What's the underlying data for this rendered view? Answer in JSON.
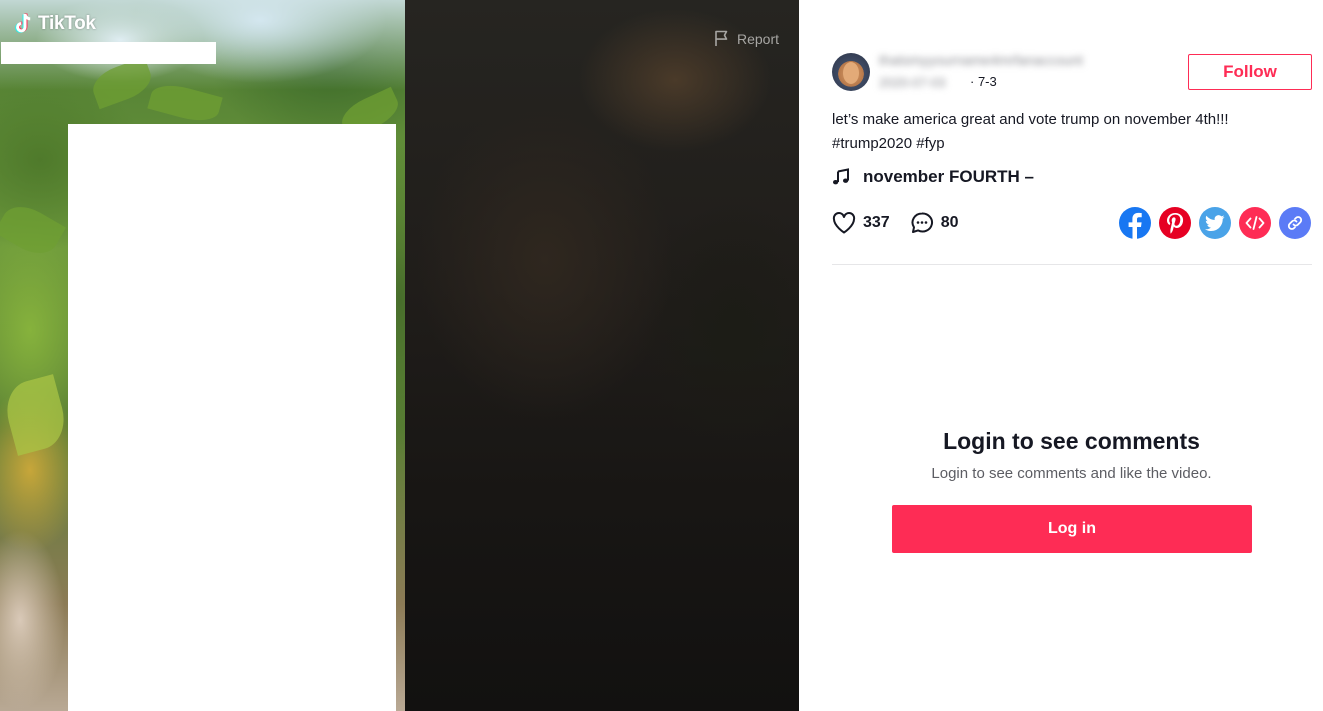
{
  "brand": {
    "logo_text": "TikTok",
    "accent": "#fe2c55"
  },
  "video": {
    "report_label": "Report",
    "report_icon": "flag-icon"
  },
  "author": {
    "username_obscured": "thatsmyyourname4mrfanaccount",
    "date_obscured": "2020-07-03",
    "date_suffix": "· 7-3",
    "follow_label": "Follow"
  },
  "post": {
    "caption_line1": "let’s make america great and vote trump on november 4th!!!",
    "caption_line2": "#trump2020 #fyp",
    "music_title": "november FOURTH –",
    "music_icon": "music-note-icon"
  },
  "stats": {
    "likes": "337",
    "comments": "80",
    "like_icon": "heart-icon",
    "comment_icon": "comment-icon"
  },
  "share": [
    {
      "name": "facebook",
      "color": "#1877f2"
    },
    {
      "name": "pinterest",
      "color": "#e60023"
    },
    {
      "name": "twitter",
      "color": "#1da1f2"
    },
    {
      "name": "embed",
      "color": "#fe2c55"
    },
    {
      "name": "copy-link",
      "color": "#5b7bf6"
    }
  ],
  "comments": {
    "title": "Login to see comments",
    "subtitle": "Login to see comments and like the video.",
    "login_label": "Log in"
  }
}
